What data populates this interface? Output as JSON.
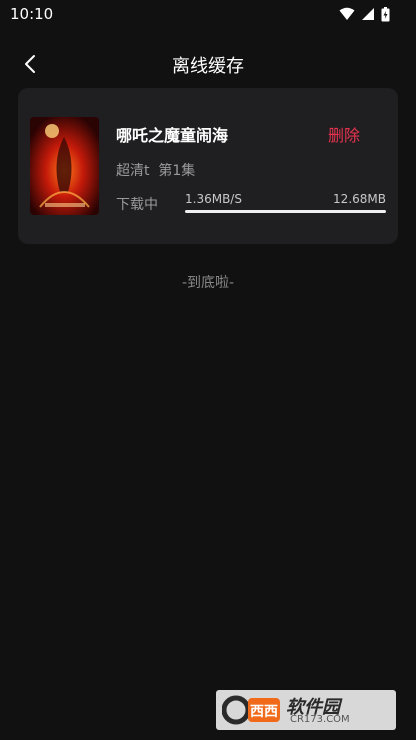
{
  "status_bar": {
    "time": "10:10",
    "icons": [
      "wifi-icon",
      "signal-icon",
      "battery-icon"
    ]
  },
  "nav": {
    "back_icon": "chevron-left-icon",
    "title": "离线缓存"
  },
  "downloads": [
    {
      "title": "哪吒之魔童闹海",
      "delete_label": "删除",
      "meta": "超清t  第1集",
      "status": "下载中",
      "speed": "1.36MB/S",
      "size": "12.68MB",
      "progress": 1.0
    }
  ],
  "footer_note": "-到底啦-",
  "watermark": {
    "site": "软件园",
    "domain": "CR173.COM"
  },
  "colors": {
    "background": "#111111",
    "card": "#1f1f21",
    "accent_delete": "#e8324f"
  }
}
